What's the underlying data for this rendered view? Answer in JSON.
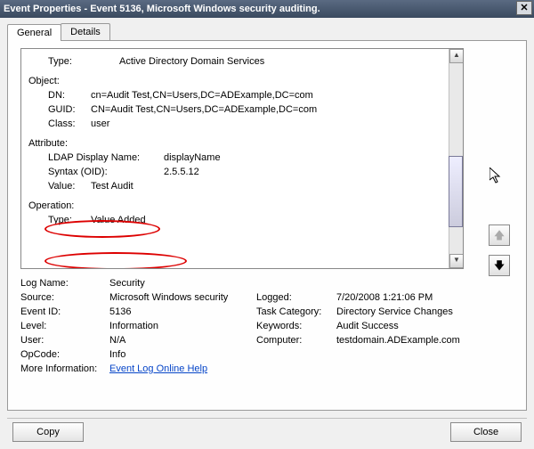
{
  "window": {
    "title": "Event Properties - Event 5136, Microsoft Windows security auditing."
  },
  "tabs": {
    "general": "General",
    "details": "Details"
  },
  "body": {
    "type_label": "Type:",
    "type_value": "Active Directory Domain Services",
    "object_label": "Object:",
    "dn_label": "DN:",
    "dn_value": "cn=Audit Test,CN=Users,DC=ADExample,DC=com",
    "guid_label": "GUID:",
    "guid_value": "CN=Audit Test,CN=Users,DC=ADExample,DC=com",
    "class_label": "Class:",
    "class_value": "user",
    "attribute_label": "Attribute:",
    "ldap_name_label": "LDAP Display Name:",
    "ldap_name_value": "displayName",
    "syntax_label": "Syntax (OID):",
    "syntax_value": "2.5.5.12",
    "value_label": "Value:",
    "value_value": "Test Audit",
    "operation_label": "Operation:",
    "op_type_label": "Type:",
    "op_type_value": "Value Added"
  },
  "props": {
    "logname_l": "Log Name:",
    "logname_v": "Security",
    "source_l": "Source:",
    "source_v": "Microsoft Windows security",
    "logged_l": "Logged:",
    "logged_v": "7/20/2008 1:21:06 PM",
    "eventid_l": "Event ID:",
    "eventid_v": "5136",
    "taskcat_l": "Task Category:",
    "taskcat_v": "Directory Service Changes",
    "level_l": "Level:",
    "level_v": "Information",
    "keywords_l": "Keywords:",
    "keywords_v": "Audit Success",
    "user_l": "User:",
    "user_v": "N/A",
    "computer_l": "Computer:",
    "computer_v": "testdomain.ADExample.com",
    "opcode_l": "OpCode:",
    "opcode_v": "Info",
    "moreinfo_l": "More Information:",
    "moreinfo_link": "Event Log Online Help"
  },
  "buttons": {
    "copy": "Copy",
    "close": "Close"
  }
}
